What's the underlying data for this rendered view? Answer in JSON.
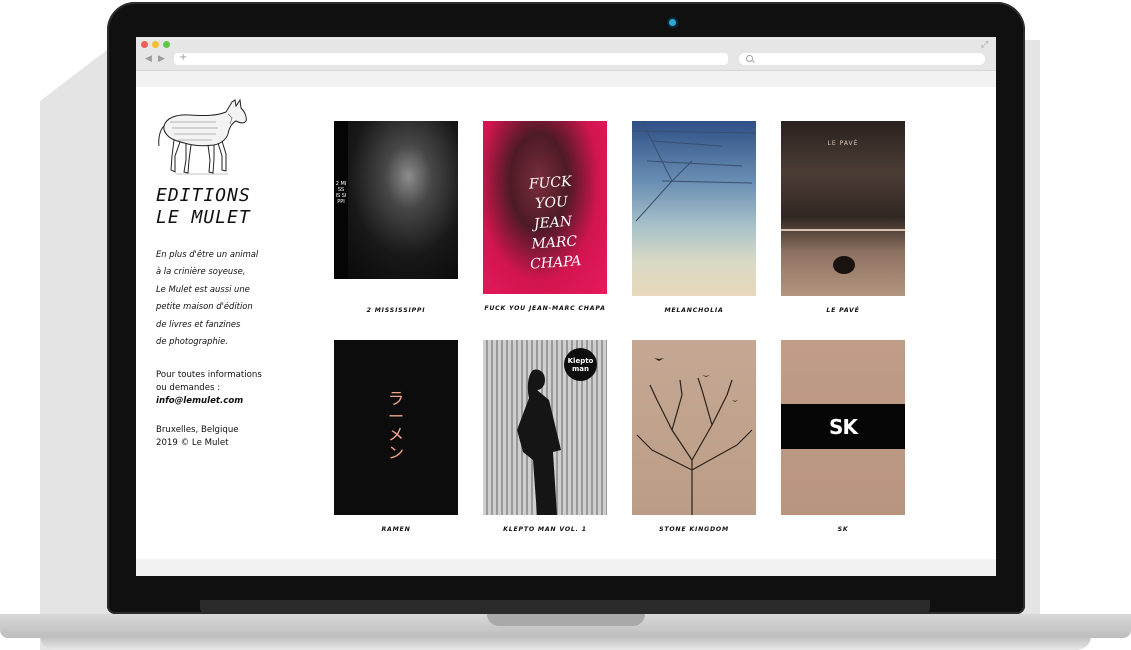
{
  "sidebar": {
    "logo_name": "donkey-logo",
    "title_line1": "EDITIONS",
    "title_line2": "LE MULET",
    "about": [
      "En plus d'être un animal",
      "à la crinière soyeuse,",
      "Le Mulet est aussi une",
      "petite maison d'édition",
      "de livres et fanzines",
      "de photographie."
    ],
    "contact_line1": "Pour toutes informations",
    "contact_line2": "ou demandes :",
    "email": "info@lemulet.com",
    "location_line1": "Bruxelles, Belgique",
    "location_line2": "2019 © Le Mulet"
  },
  "books": [
    {
      "title": "2 MISSISSIPPI",
      "cover_text": "2 MI SS IS SI PPI"
    },
    {
      "title": "FUCK YOU JEAN-MARC CHAPA",
      "cover_text": "FUCK YOU JEAN MARC CHAPA"
    },
    {
      "title": "MELANCHOLIA"
    },
    {
      "title": "LE PAVÉ",
      "cover_text": "LE PAVÉ"
    },
    {
      "title": "RAMEN",
      "cover_text": "ラーメン"
    },
    {
      "title": "KLEPTO MAN VOL. 1",
      "cover_text": "Klepto man"
    },
    {
      "title": "STONE KINGDOM"
    },
    {
      "title": "SK",
      "cover_text": "SK"
    }
  ],
  "colors": {
    "accent_pink": "#e61a5c",
    "camera": "#2aa7d6"
  }
}
